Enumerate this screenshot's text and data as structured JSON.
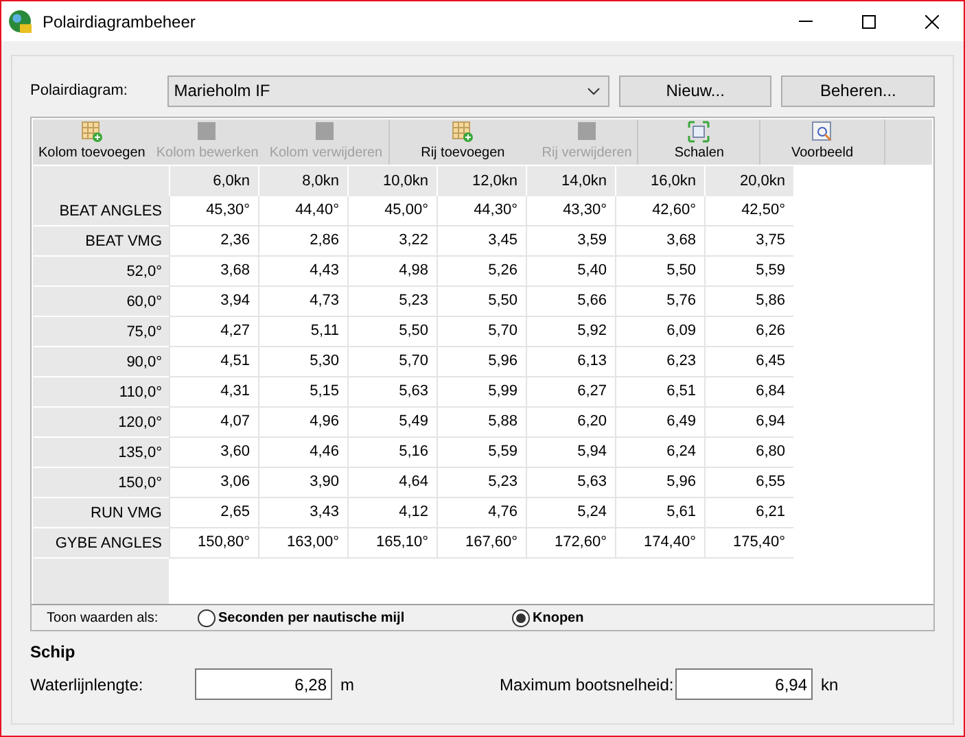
{
  "window": {
    "title": "Polairdiagrambeheer"
  },
  "polar_select": {
    "label": "Polairdiagram:",
    "value": "Marieholm IF"
  },
  "buttons": [
    "Nieuw...",
    "Beheren..."
  ],
  "toolbar": [
    [
      {
        "label": "Kolom toevoegen",
        "disabled": false
      },
      {
        "label": "Kolom bewerken",
        "disabled": true
      },
      {
        "label": "Kolom verwijderen",
        "disabled": true
      }
    ],
    [
      {
        "label": "Rij toevoegen",
        "disabled": false
      },
      {
        "label": "Rij verwijderen",
        "disabled": true
      }
    ],
    [
      {
        "label": "Schalen",
        "disabled": false
      }
    ],
    [
      {
        "label": "Voorbeeld",
        "disabled": false
      }
    ]
  ],
  "table": {
    "columns": [
      "6,0kn",
      "8,0kn",
      "10,0kn",
      "12,0kn",
      "14,0kn",
      "16,0kn",
      "20,0kn"
    ],
    "rows": [
      {
        "label": "BEAT ANGLES",
        "cells": [
          "45,30°",
          "44,40°",
          "45,00°",
          "44,30°",
          "43,30°",
          "42,60°",
          "42,50°"
        ]
      },
      {
        "label": "BEAT VMG",
        "cells": [
          "2,36",
          "2,86",
          "3,22",
          "3,45",
          "3,59",
          "3,68",
          "3,75"
        ]
      },
      {
        "label": "52,0°",
        "cells": [
          "3,68",
          "4,43",
          "4,98",
          "5,26",
          "5,40",
          "5,50",
          "5,59"
        ]
      },
      {
        "label": "60,0°",
        "cells": [
          "3,94",
          "4,73",
          "5,23",
          "5,50",
          "5,66",
          "5,76",
          "5,86"
        ]
      },
      {
        "label": "75,0°",
        "cells": [
          "4,27",
          "5,11",
          "5,50",
          "5,70",
          "5,92",
          "6,09",
          "6,26"
        ]
      },
      {
        "label": "90,0°",
        "cells": [
          "4,51",
          "5,30",
          "5,70",
          "5,96",
          "6,13",
          "6,23",
          "6,45"
        ]
      },
      {
        "label": "110,0°",
        "cells": [
          "4,31",
          "5,15",
          "5,63",
          "5,99",
          "6,27",
          "6,51",
          "6,84"
        ]
      },
      {
        "label": "120,0°",
        "cells": [
          "4,07",
          "4,96",
          "5,49",
          "5,88",
          "6,20",
          "6,49",
          "6,94"
        ]
      },
      {
        "label": "135,0°",
        "cells": [
          "3,60",
          "4,46",
          "5,16",
          "5,59",
          "5,94",
          "6,24",
          "6,80"
        ]
      },
      {
        "label": "150,0°",
        "cells": [
          "3,06",
          "3,90",
          "4,64",
          "5,23",
          "5,63",
          "5,96",
          "6,55"
        ]
      },
      {
        "label": "RUN VMG",
        "cells": [
          "2,65",
          "3,43",
          "4,12",
          "4,76",
          "5,24",
          "5,61",
          "6,21"
        ]
      },
      {
        "label": "GYBE ANGLES",
        "cells": [
          "150,80°",
          "163,00°",
          "165,10°",
          "167,60°",
          "172,60°",
          "174,40°",
          "175,40°"
        ]
      }
    ]
  },
  "display_as": {
    "label": "Toon waarden als:",
    "options": [
      {
        "label": "Seconden per nautische mijl",
        "selected": false
      },
      {
        "label": "Knopen",
        "selected": true
      }
    ]
  },
  "ship": {
    "title": "Schip",
    "fields": [
      {
        "label": "Waterlijnlengte:",
        "value": "6,28",
        "unit": "m"
      },
      {
        "label": "Maximum bootsnelheid:",
        "value": "6,94",
        "unit": "kn"
      }
    ]
  }
}
